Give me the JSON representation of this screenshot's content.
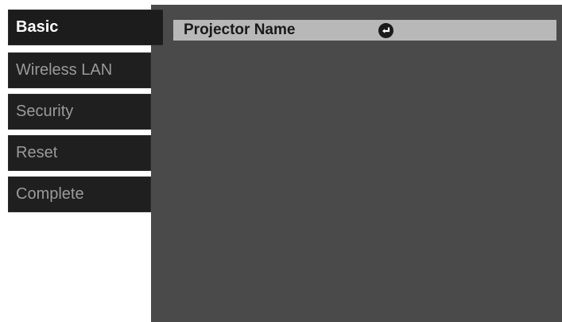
{
  "sidebar": {
    "items": [
      {
        "label": "Basic",
        "active": true
      },
      {
        "label": "Wireless LAN",
        "active": false
      },
      {
        "label": "Security",
        "active": false
      },
      {
        "label": "Reset",
        "active": false
      },
      {
        "label": "Complete",
        "active": false
      }
    ]
  },
  "main": {
    "rows": [
      {
        "label": "Projector Name",
        "icon": "enter-icon"
      }
    ]
  },
  "colors": {
    "tab_bg": "#1f1f1f",
    "tab_active_text": "#ffffff",
    "tab_inactive_text": "#9a9a9a",
    "panel_bg": "#4a4a4a",
    "row_highlight": "#b8b8b8"
  }
}
